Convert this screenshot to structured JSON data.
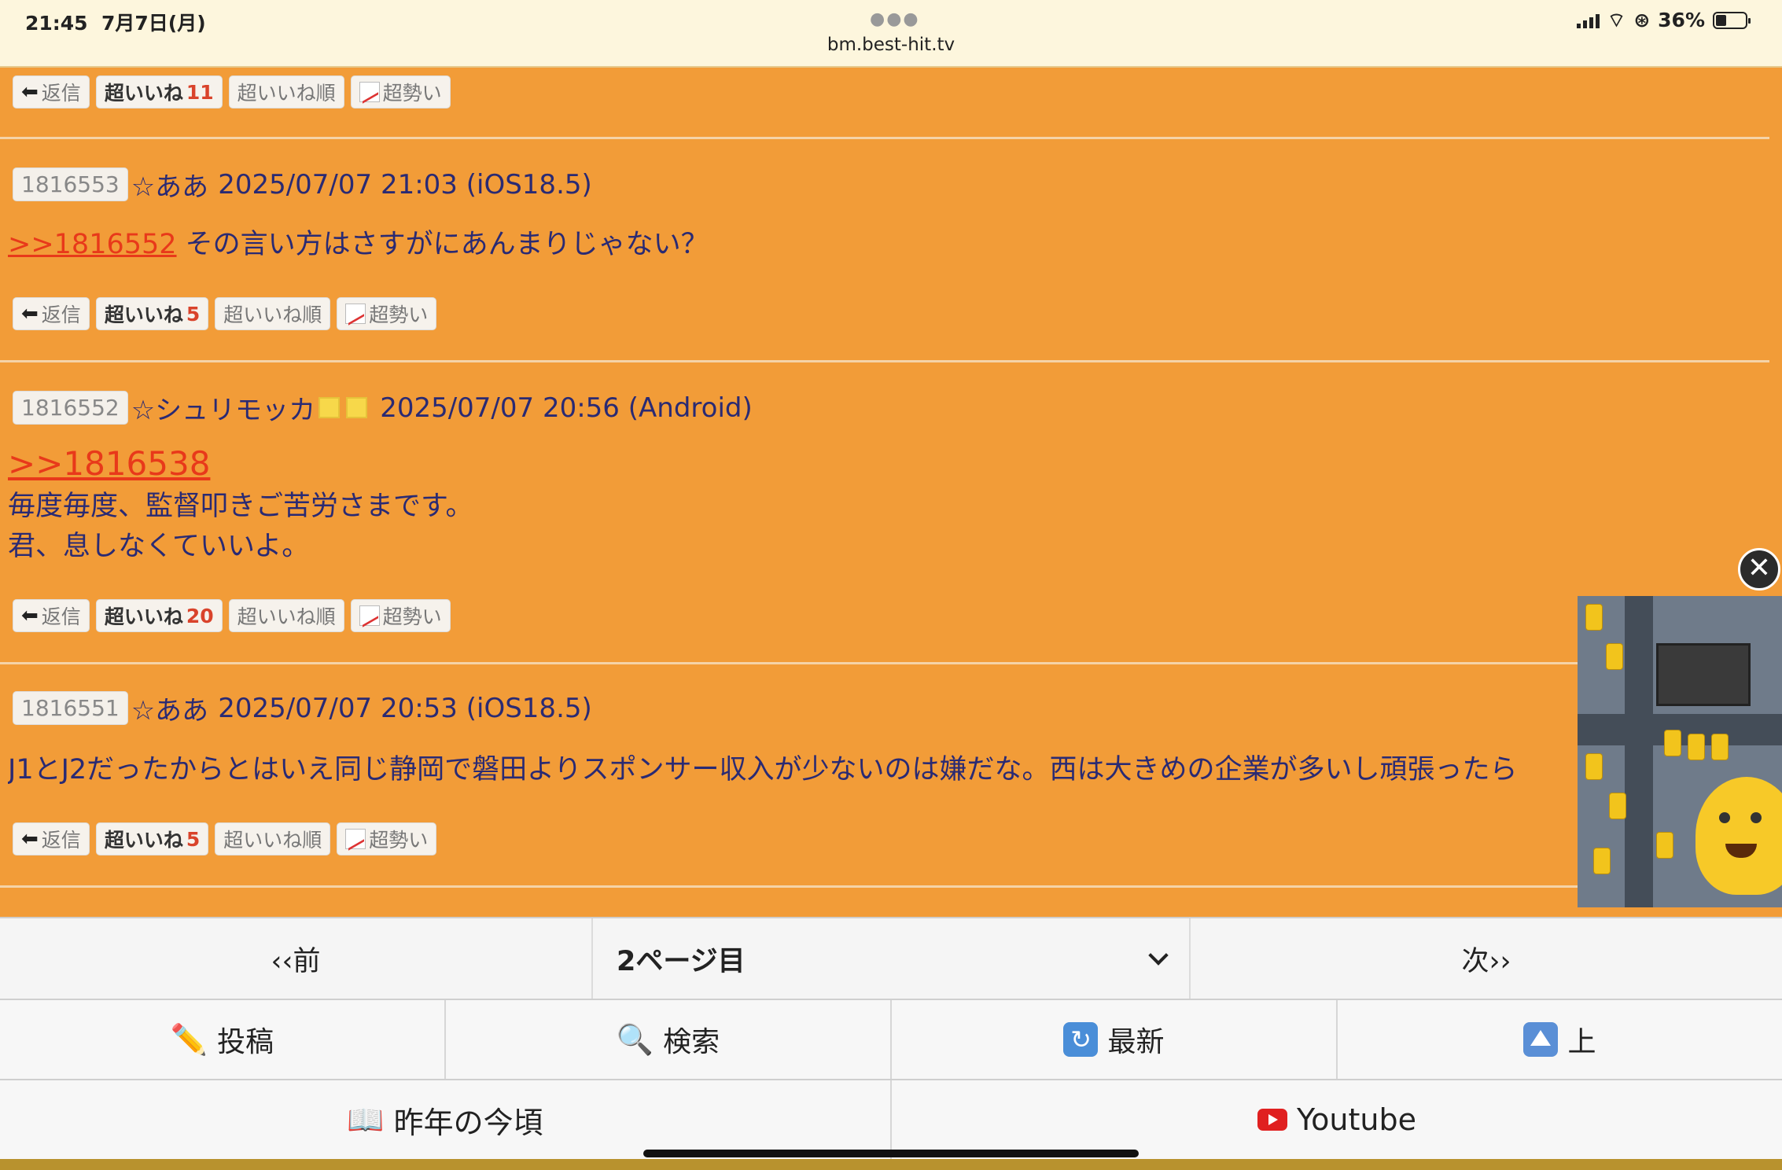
{
  "status_bar": {
    "time": "21:45",
    "date": "7月7日(月)",
    "url": "bm.best-hit.tv",
    "battery": "36%"
  },
  "buttons": {
    "reply": "返信",
    "super_like": "超いいね",
    "super_like_order": "超いいね順",
    "super_momentum": "超勢い"
  },
  "top_post": {
    "likes": "11"
  },
  "posts": [
    {
      "id": "1816553",
      "name": "☆ああ",
      "date": "2025/07/07 21:03 (iOS18.5)",
      "anchor": ">>1816552",
      "lines": [
        "その言い方はさすがにあんまりじゃない？"
      ],
      "likes": "5"
    },
    {
      "id": "1816552",
      "name": "☆シュリモッカ",
      "date": "2025/07/07 20:56 (Android)",
      "anchor": ">>1816538",
      "lines": [
        "毎度毎度、監督叩きご苦労さまです。",
        "君、息しなくていいよ。"
      ],
      "likes": "20"
    },
    {
      "id": "1816551",
      "name": "☆ああ",
      "date": "2025/07/07 20:53 (iOS18.5)",
      "anchor": "",
      "lines": [
        "J1とJ2だったからとはいえ同じ静岡で磐田よりスポンサー収入が少ないのは嫌だな。西は大きめの企業が多いし頑張ったら"
      ],
      "likes": "5"
    }
  ],
  "pager": {
    "prev": "‹‹前",
    "current": "2ページ目",
    "next": "次››"
  },
  "toolbar": {
    "post": "投稿",
    "search": "検索",
    "latest": "最新",
    "top": "上",
    "last_year": "昨年の今頃",
    "youtube": "Youtube"
  },
  "icons": {
    "post": "pencil-icon",
    "search": "magnifier-icon",
    "latest": "refresh-icon",
    "top": "up-arrow-icon",
    "last_year": "book-icon",
    "youtube": "youtube-icon",
    "ad_close": "close-icon"
  },
  "colors": {
    "background": "#f29c38",
    "text": "#2a2a73",
    "anchor": "#e8391a"
  }
}
